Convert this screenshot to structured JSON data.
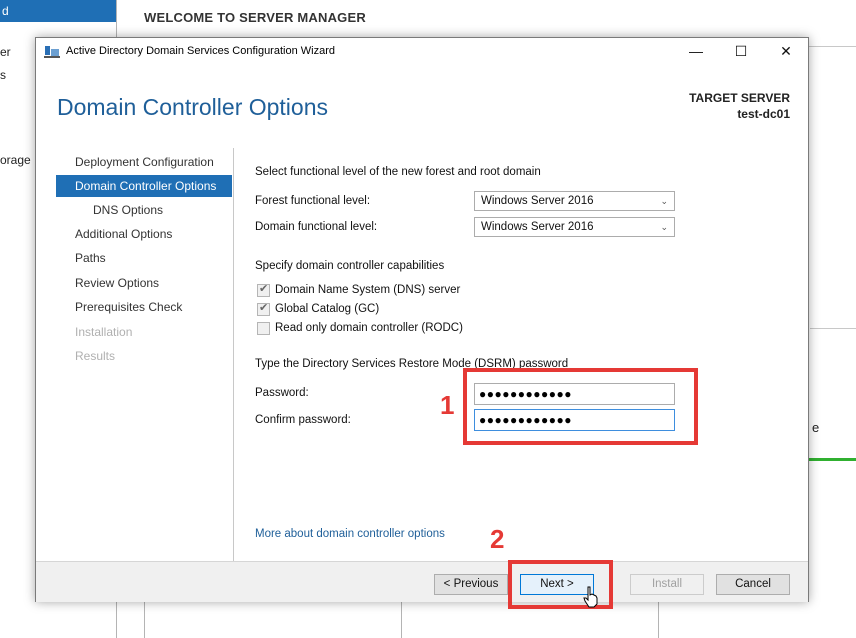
{
  "background": {
    "title": "WELCOME TO SERVER MANAGER",
    "left_items": [
      "d",
      "er",
      "s",
      "orage"
    ],
    "panel_text": "e"
  },
  "window": {
    "title": "Active Directory Domain Services Configuration Wizard",
    "controls": {
      "minimize": "—",
      "maximize": "☐",
      "close": "✕"
    },
    "heading": "Domain Controller Options",
    "target_label": "TARGET SERVER",
    "target_value": "test-dc01"
  },
  "nav": {
    "items": [
      {
        "label": "Deployment Configuration",
        "state": "normal"
      },
      {
        "label": "Domain Controller Options",
        "state": "selected"
      },
      {
        "label": "DNS Options",
        "state": "sub"
      },
      {
        "label": "Additional Options",
        "state": "normal"
      },
      {
        "label": "Paths",
        "state": "normal"
      },
      {
        "label": "Review Options",
        "state": "normal"
      },
      {
        "label": "Prerequisites Check",
        "state": "normal"
      },
      {
        "label": "Installation",
        "state": "disabled"
      },
      {
        "label": "Results",
        "state": "disabled"
      }
    ]
  },
  "form": {
    "functional_heading": "Select functional level of the new forest and root domain",
    "forest_label": "Forest functional level:",
    "forest_value": "Windows Server 2016",
    "domain_label": "Domain functional level:",
    "domain_value": "Windows Server 2016",
    "capabilities_heading": "Specify domain controller capabilities",
    "capabilities": [
      {
        "label": "Domain Name System (DNS) server",
        "checked": true
      },
      {
        "label": "Global Catalog (GC)",
        "checked": true
      },
      {
        "label": "Read only domain controller (RODC)",
        "checked": false
      }
    ],
    "dsrm_heading": "Type the Directory Services Restore Mode (DSRM) password",
    "password_label": "Password:",
    "password_value": "●●●●●●●●●●●●",
    "confirm_label": "Confirm password:",
    "confirm_value": "●●●●●●●●●●●●",
    "more_link": "More about domain controller options"
  },
  "footer": {
    "previous": "< Previous",
    "next": "Next >",
    "install": "Install",
    "cancel": "Cancel"
  },
  "annotations": {
    "one": "1",
    "two": "2",
    "color": "#e53935"
  }
}
